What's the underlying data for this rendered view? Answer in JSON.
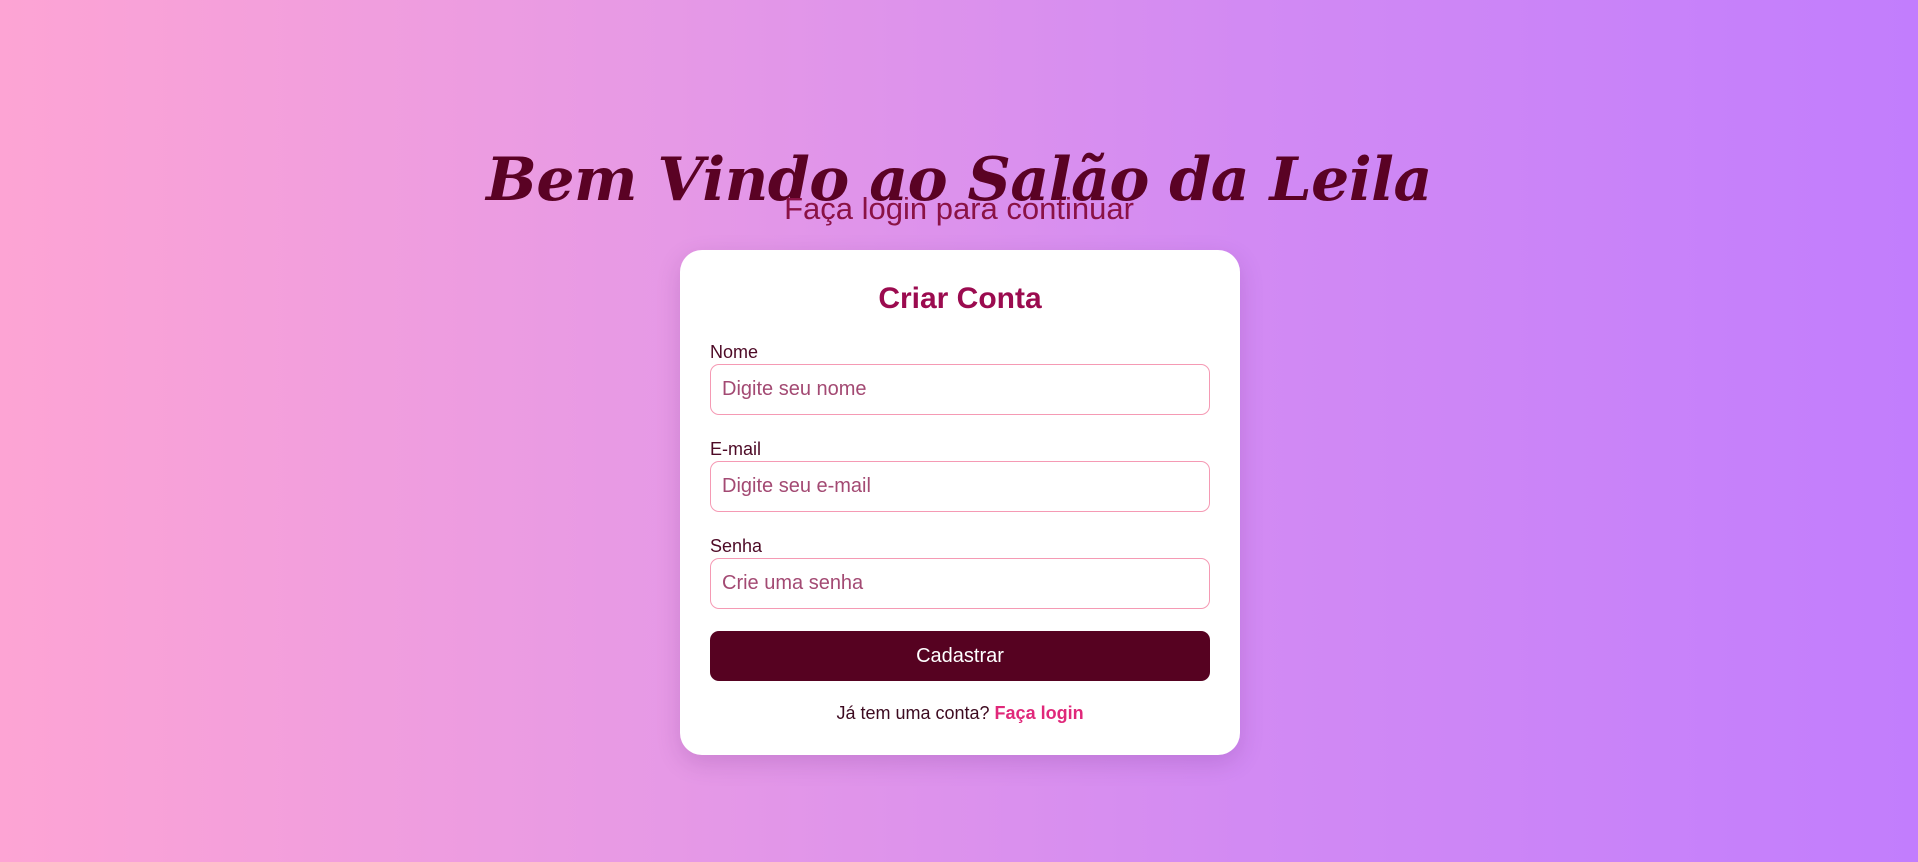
{
  "header": {
    "title": "Bem Vindo ao Salão da Leila",
    "subtitle": "Faça login para continuar"
  },
  "form": {
    "title": "Criar Conta",
    "fields": [
      {
        "label": "Nome",
        "placeholder": "Digite seu nome",
        "value": ""
      },
      {
        "label": "E-mail",
        "placeholder": "Digite seu e-mail",
        "value": ""
      },
      {
        "label": "Senha",
        "placeholder": "Crie uma senha",
        "value": ""
      }
    ],
    "submit_label": "Cadastrar",
    "footer_text": "Já tem uma conta?",
    "login_link": "Faça login"
  },
  "colors": {
    "gradient_start": "#fda4d4",
    "gradient_end": "#c27dfd",
    "title": "#5a0224",
    "subtitle": "#8a1245",
    "card_title": "#9b0b4f",
    "button": "#560221",
    "link": "#e0287a",
    "input_border": "#f59ab4"
  }
}
